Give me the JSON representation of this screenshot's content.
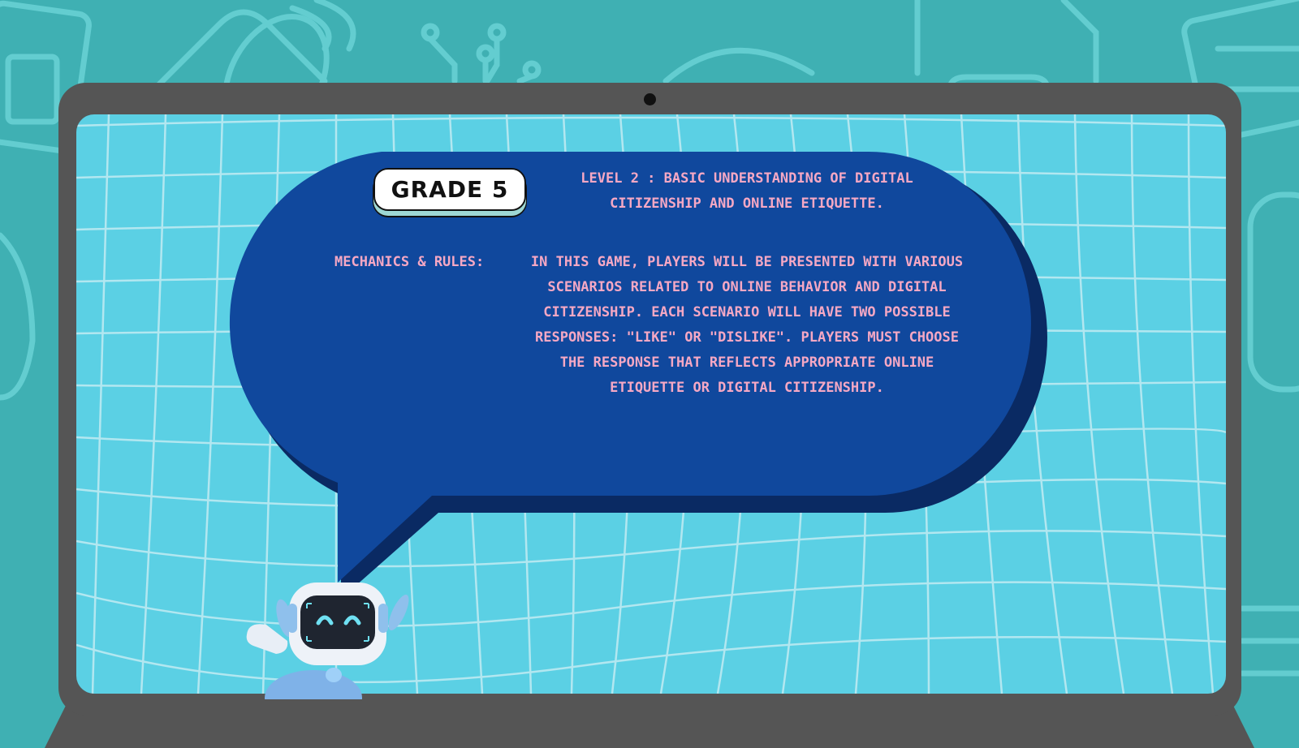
{
  "grade_badge": "GRADE 5",
  "level_title": "LEVEL 2 : BASIC UNDERSTANDING OF DIGITAL CITIZENSHIP AND ONLINE ETIQUETTE.",
  "mechanics_label": "MECHANICS & RULES:",
  "rules_text": "IN THIS GAME, PLAYERS WILL BE PRESENTED WITH VARIOUS SCENARIOS RELATED TO ONLINE BEHAVIOR AND DIGITAL CITIZENSHIP. EACH SCENARIO WILL HAVE TWO POSSIBLE RESPONSES: \"LIKE\" OR \"DISLIKE\". PLAYERS MUST CHOOSE THE RESPONSE THAT REFLECTS APPROPRIATE ONLINE ETIQUETTE OR DIGITAL CITIZENSHIP.",
  "colors": {
    "background": "#3fb0b3",
    "laptop": "#555555",
    "screen": "#5bd0e4",
    "bubble": "#10489d",
    "bubble_shadow": "#0a2a63",
    "text_pink": "#f6a8c4"
  }
}
